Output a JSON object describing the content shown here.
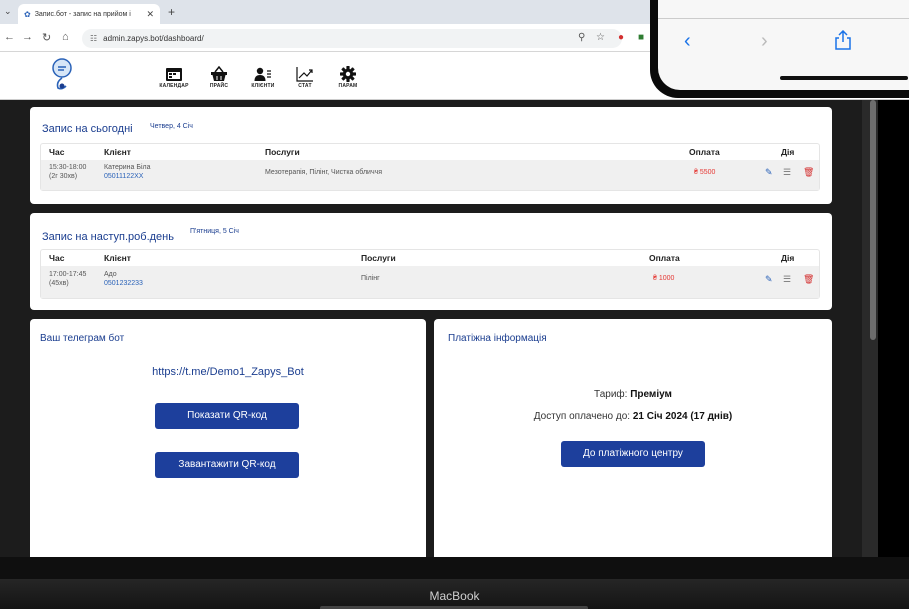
{
  "browser": {
    "tab_title": "Запис.бот - запис на прийом і",
    "url": "admin.zapys.bot/dashboard/"
  },
  "nav": {
    "items": [
      {
        "label": "КАЛЕНДАР",
        "icon": "calendar-icon"
      },
      {
        "label": "ПРАЙС",
        "icon": "basket-icon"
      },
      {
        "label": "КЛІЄНТИ",
        "icon": "clients-icon"
      },
      {
        "label": "СТАТ",
        "icon": "chart-icon"
      },
      {
        "label": "ПАРАМ",
        "icon": "gear-icon"
      }
    ]
  },
  "today": {
    "title": "Запис на сьогодні",
    "date": "Четвер, 4 Січ",
    "headers": {
      "time": "Час",
      "client": "Клієнт",
      "services": "Послуги",
      "payment": "Оплата",
      "action": "Дія"
    },
    "row": {
      "time": "15:30-18:00",
      "duration": "(2г 30хв)",
      "client_name": "Катерина Біла",
      "client_phone": "05011122XX",
      "services": "Мезотерапія, Пілінг, Чистка обличчя",
      "payment": "₴ 5500"
    }
  },
  "next": {
    "title": "Запис на наступ.роб.день",
    "date": "П'ятниця, 5 Січ",
    "headers": {
      "time": "Час",
      "client": "Клієнт",
      "services": "Послуги",
      "payment": "Оплата",
      "action": "Дія"
    },
    "row": {
      "time": "17:00-17:45",
      "duration": "(45хв)",
      "client_name": "Адо",
      "client_phone": "0501232233",
      "services": "Пілінг",
      "payment": "₴ 1000"
    }
  },
  "bot": {
    "title": "Ваш телеграм бот",
    "url": "https://t.me/Demo1_Zapys_Bot",
    "show_qr": "Показати QR-код",
    "download_qr": "Завантажити QR-код"
  },
  "payment": {
    "title": "Платіжна інформація",
    "tariff_label": "Тариф:",
    "tariff_value": "Преміум",
    "access_label": "Доступ оплачено до:",
    "access_value": "21 Січ 2024 (17 днів)",
    "center_button": "До платіжного центру"
  },
  "device": {
    "brand": "MacBook"
  },
  "colors": {
    "accent": "#1d3f9c",
    "title_blue": "#1a3d8f",
    "price_red": "#e53935",
    "link_blue": "#2a62b8"
  }
}
